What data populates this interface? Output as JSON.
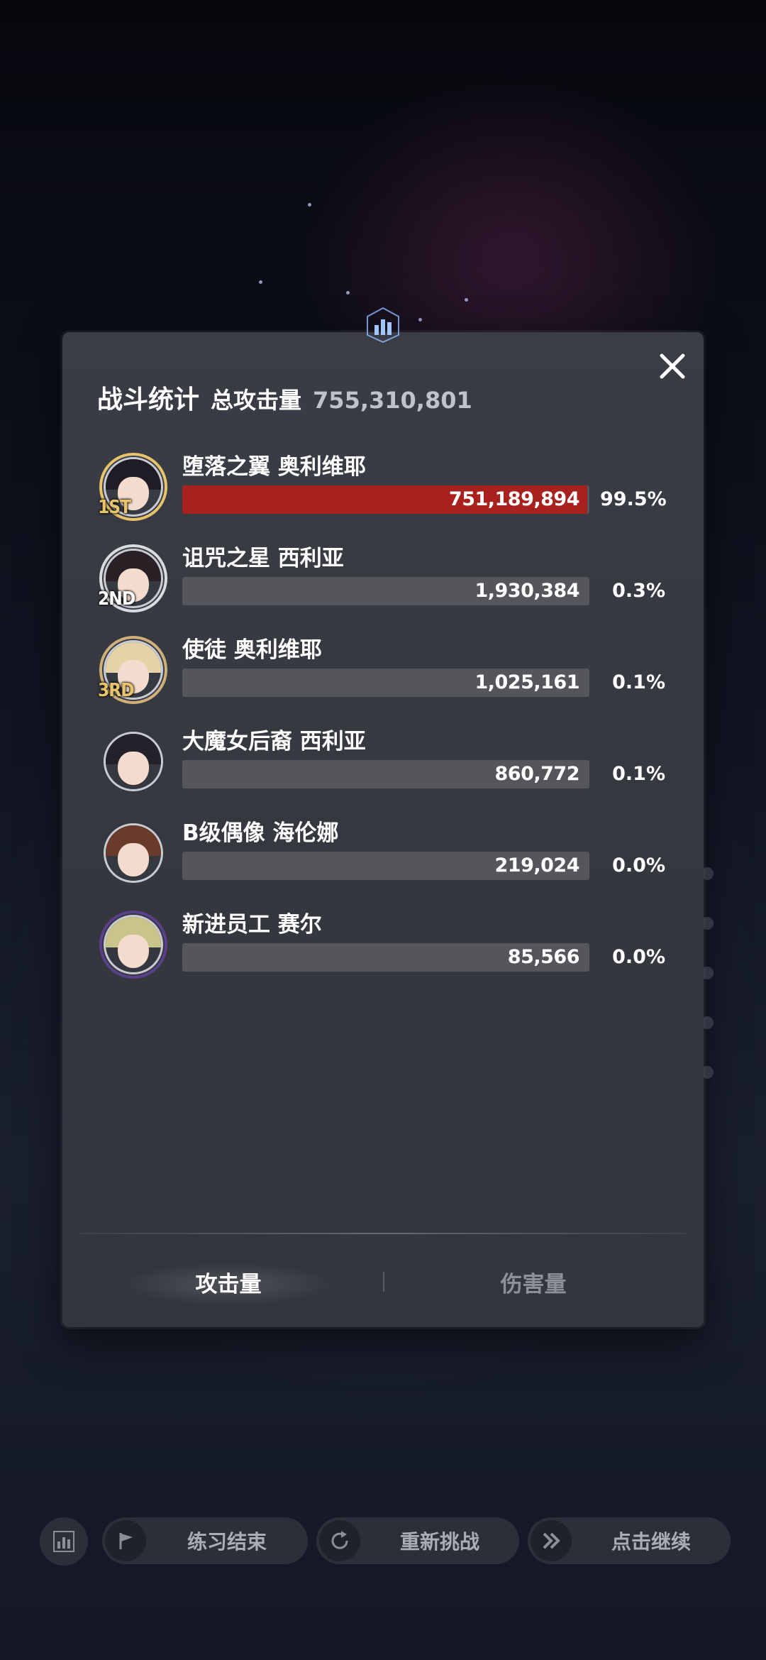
{
  "header": {
    "title": "战斗统计",
    "total_label": "总攻击量",
    "total_value": "755,310,801"
  },
  "rows": [
    {
      "rank": "1ST",
      "name": "堕落之翼 奥利维耶",
      "value": "751,189,894",
      "percent": "99.5%",
      "share": 0.995,
      "highlight": true,
      "hair": "#1f1c26"
    },
    {
      "rank": "2ND",
      "name": "诅咒之星 西利亚",
      "value": "1,930,384",
      "percent": "0.3%",
      "share": 0.003,
      "highlight": false,
      "hair": "#2a2126"
    },
    {
      "rank": "3RD",
      "name": "使徒 奥利维耶",
      "value": "1,025,161",
      "percent": "0.1%",
      "share": 0.001,
      "highlight": false,
      "hair": "#e4d3a6"
    },
    {
      "rank": "",
      "name": "大魔女后裔 西利亚",
      "value": "860,772",
      "percent": "0.1%",
      "share": 0.001,
      "highlight": false,
      "hair": "#23222a"
    },
    {
      "rank": "",
      "name": "B级偶像 海伦娜",
      "value": "219,024",
      "percent": "0.0%",
      "share": 0.0,
      "highlight": false,
      "hair": "#6a3b2a"
    },
    {
      "rank": "",
      "name": "新进员工 赛尔",
      "value": "85,566",
      "percent": "0.0%",
      "share": 0.0,
      "highlight": false,
      "hair": "#c9c48a"
    }
  ],
  "tabs": {
    "attack": "攻击量",
    "damage": "伤害量"
  },
  "bottom_bar": {
    "practice_end": "练习结束",
    "retry": "重新挑战",
    "continue": "点击继续"
  },
  "colors": {
    "highlight_bar": "#a9211f",
    "bar_bg": "#54565c",
    "gold": "#e8c36a",
    "silver": "#d9dbe0"
  }
}
